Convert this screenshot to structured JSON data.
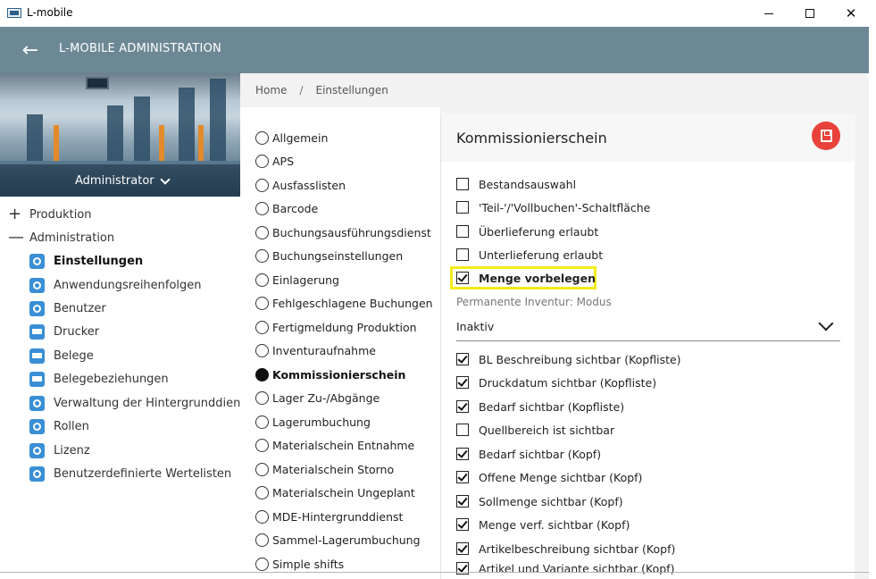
{
  "window": {
    "title": "L-mobile"
  },
  "header": {
    "title": "L-MOBILE ADMINISTRATION"
  },
  "sidebar": {
    "user": "Administrator",
    "groups": [
      {
        "sign": "+",
        "label": "Produktion"
      },
      {
        "sign": "—",
        "label": "Administration"
      }
    ],
    "items": [
      {
        "label": "Einstellungen",
        "icon": "gear-icon",
        "active": true
      },
      {
        "label": "Anwendungsreihenfolgen",
        "icon": "gear-icon"
      },
      {
        "label": "Benutzer",
        "icon": "gear-icon"
      },
      {
        "label": "Drucker",
        "icon": "printer-icon"
      },
      {
        "label": "Belege",
        "icon": "printer-icon"
      },
      {
        "label": "Belegebeziehungen",
        "icon": "printer-icon"
      },
      {
        "label": "Verwaltung der Hintergrunddienste",
        "icon": "gear-icon"
      },
      {
        "label": "Rollen",
        "icon": "gear-icon"
      },
      {
        "label": "Lizenz",
        "icon": "gear-icon"
      },
      {
        "label": "Benutzerdefinierte Wertelisten",
        "icon": "gear-icon"
      }
    ]
  },
  "breadcrumb": {
    "home": "Home",
    "sep": "/",
    "current": "Einstellungen"
  },
  "sections": [
    "Allgemein",
    "APS",
    "Ausfasslisten",
    "Barcode",
    "Buchungsausführungsdienst",
    "Buchungseinstellungen",
    "Einlagerung",
    "Fehlgeschlagene Buchungen",
    "Fertigmeldung Produktion",
    "Inventuraufnahme",
    "Kommissionierschein",
    "Lager Zu-/Abgänge",
    "Lagerumbuchung",
    "Materialschein Entnahme",
    "Materialschein Storno",
    "Materialschein Ungeplant",
    "MDE-Hintergrunddienst",
    "Sammel-Lagerumbuchung",
    "Simple shifts"
  ],
  "selected_section_index": 10,
  "detail": {
    "title": "Kommissionierschein",
    "options_top": [
      {
        "label": "Bestandsauswahl",
        "checked": false
      },
      {
        "label": "'Teil-'/'Vollbuchen'-Schaltfläche",
        "checked": false
      },
      {
        "label": "Überlieferung erlaubt",
        "checked": false
      },
      {
        "label": "Unterlieferung erlaubt",
        "checked": false
      },
      {
        "label": "Menge vorbelegen",
        "checked": true,
        "highlighted": true
      }
    ],
    "inventory_mode_label": "Permanente Inventur: Modus",
    "inventory_mode_value": "Inaktiv",
    "options_bottom": [
      {
        "label": "BL Beschreibung sichtbar (Kopfliste)",
        "checked": true
      },
      {
        "label": "Druckdatum sichtbar (Kopfliste)",
        "checked": true
      },
      {
        "label": "Bedarf sichtbar (Kopfliste)",
        "checked": true
      },
      {
        "label": "Quellbereich ist sichtbar",
        "checked": false
      },
      {
        "label": "Bedarf sichtbar (Kopf)",
        "checked": true
      },
      {
        "label": "Offene Menge sichtbar (Kopf)",
        "checked": true
      },
      {
        "label": "Sollmenge sichtbar (Kopf)",
        "checked": true
      },
      {
        "label": "Menge verf. sichtbar (Kopf)",
        "checked": true
      },
      {
        "label": "Artikelbeschreibung sichtbar (Kopf)",
        "checked": true
      },
      {
        "label": "Artikel und Variante sichtbar (Kopf)",
        "checked": true
      }
    ]
  },
  "colors": {
    "header": "#6d8895",
    "accent": "#3a8fd6",
    "save": "#e8423b",
    "highlight": "#f3ec1b"
  }
}
